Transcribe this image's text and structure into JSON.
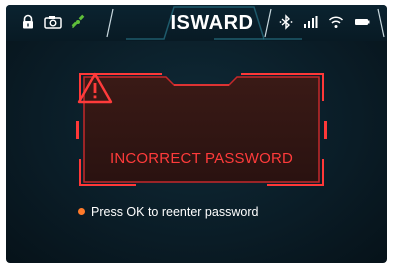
{
  "status_bar": {
    "title": "ISWARD",
    "left_icons": [
      "lock-icon",
      "camera-icon",
      "satellite-icon"
    ],
    "right_icons": [
      "bluetooth-icon",
      "cellular-signal-icon",
      "wifi-icon",
      "battery-icon"
    ]
  },
  "alert": {
    "icon": "warning-triangle-icon",
    "message": "INCORRECT PASSWORD",
    "accent_color": "#ff3b3b"
  },
  "hint": {
    "text": "Press OK to reenter password",
    "bullet_color": "#ff7a2a"
  }
}
